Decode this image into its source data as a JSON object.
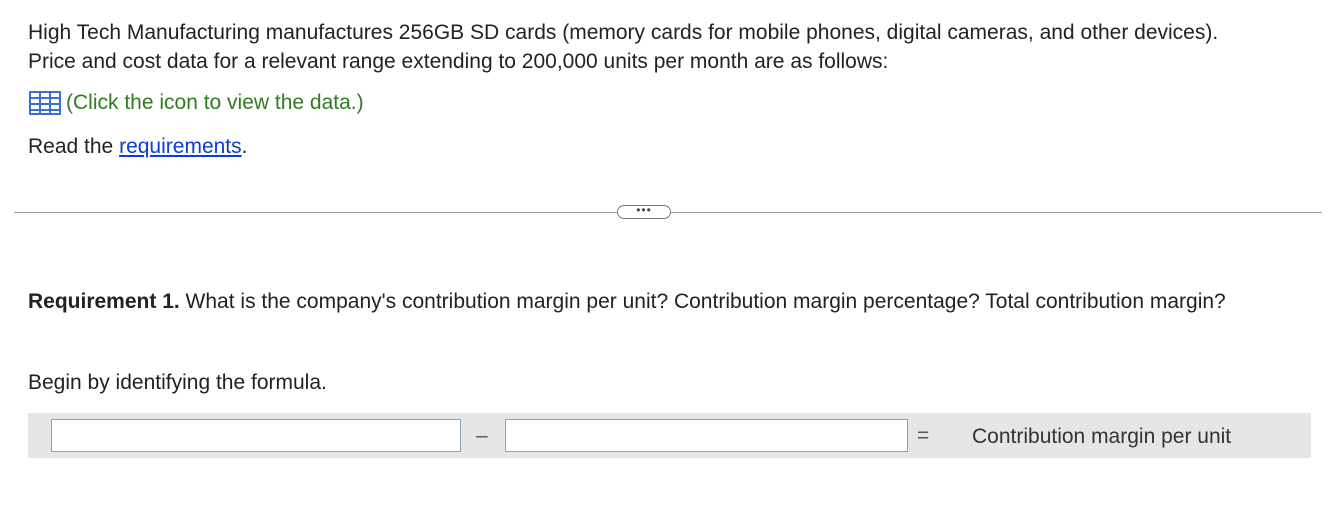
{
  "problem": {
    "intro": "High Tech Manufacturing manufactures 256GB SD cards (memory cards for mobile phones, digital cameras, and other devices). Price and cost data for a relevant range extending to 200,000 units per month are as follows:",
    "data_link_text": "(Click the icon to view the data.)",
    "data_icon": "table-grid-icon",
    "read_prefix": "Read the ",
    "requirements_link": "requirements",
    "read_suffix": "."
  },
  "divider": {
    "button_label": "•••"
  },
  "requirement": {
    "label": "Requirement 1.",
    "question": " What is the company's contribution margin per unit? Contribution margin percentage? Total contribution margin?",
    "begin_text": "Begin by identifying the formula."
  },
  "formula": {
    "operator_minus": "–",
    "operator_equals": "=",
    "result_label": "Contribution margin per unit",
    "input_1_value": "",
    "input_2_value": ""
  },
  "colors": {
    "link_green": "#2f7d1f",
    "link_blue": "#0a3dd6",
    "icon_blue": "#3d6fd0",
    "formula_bar_bg": "#e6e6e6"
  }
}
